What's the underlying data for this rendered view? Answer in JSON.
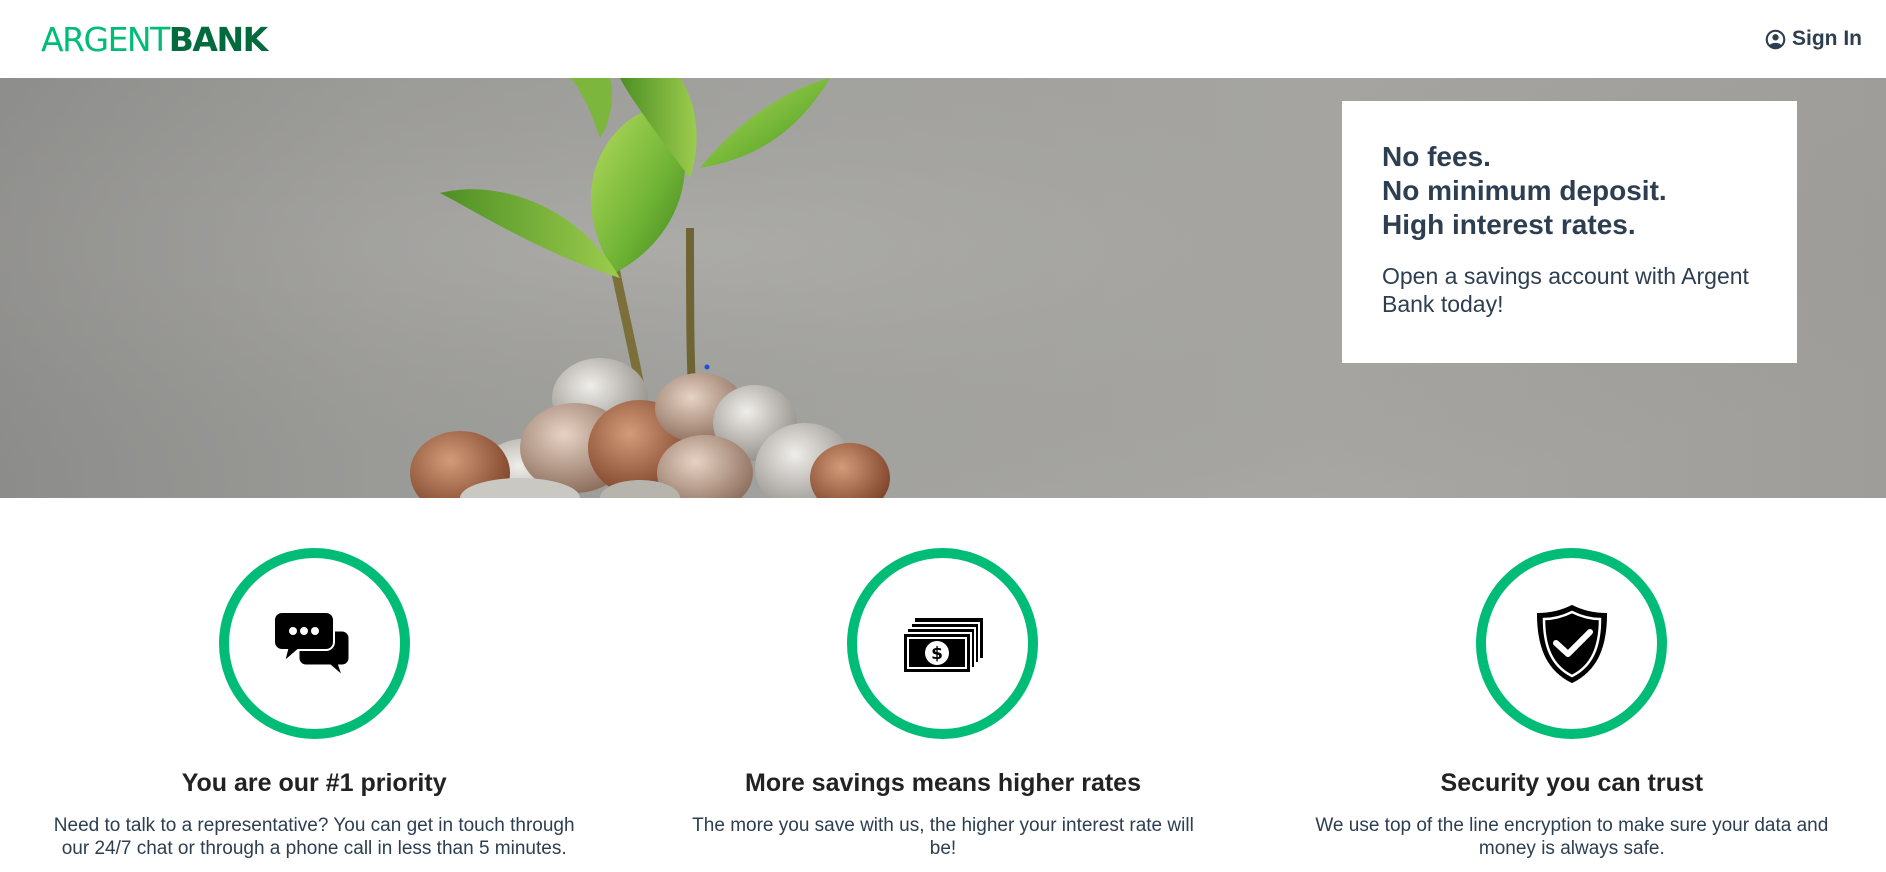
{
  "nav": {
    "logo_part1": "ARGENT",
    "logo_part2": "BANK",
    "signin_label": "Sign In",
    "signin_icon": "user-circle-icon"
  },
  "hero": {
    "subtitles": [
      "No fees.",
      "No minimum deposit.",
      "High interest rates."
    ],
    "text": "Open a savings account with Argent Bank today!"
  },
  "features": [
    {
      "icon": "chat-icon",
      "title": "You are our #1 priority",
      "text": "Need to talk to a representative? You can get in touch through our 24/7 chat or through a phone call in less than 5 minutes."
    },
    {
      "icon": "money-icon",
      "title": "More savings means higher rates",
      "text": "The more you save with us, the higher your interest rate will be!"
    },
    {
      "icon": "security-icon",
      "title": "Security you can trust",
      "text": "We use top of the line encryption to make sure your data and money is always safe."
    }
  ],
  "colors": {
    "brand_green": "#00bc77",
    "brand_dark_green": "#026b3d",
    "text": "#2c3e50"
  }
}
